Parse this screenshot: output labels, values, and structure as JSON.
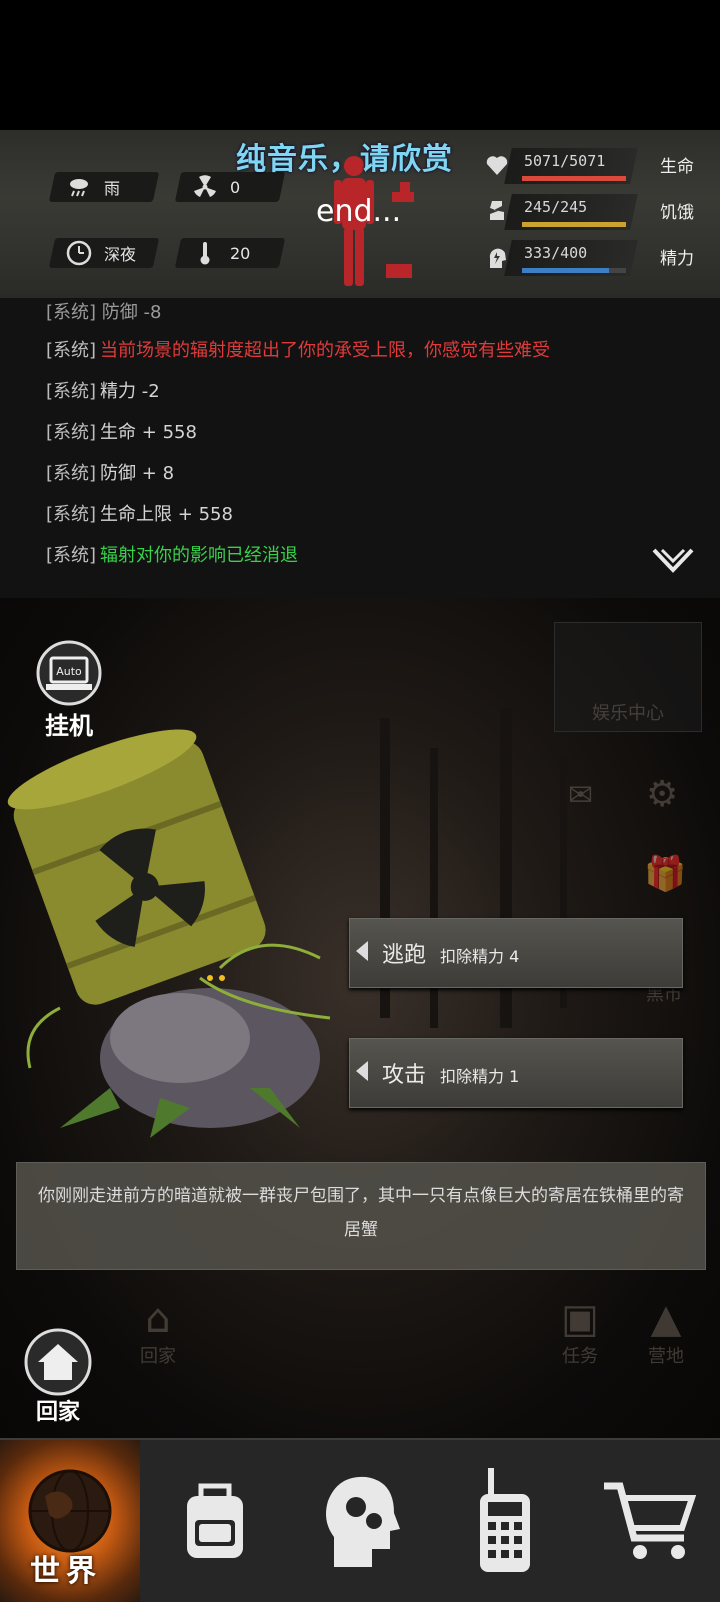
{
  "overlay": {
    "title": "纯音乐，请欣赏",
    "subtitle": "end..."
  },
  "environment": {
    "weather": "雨",
    "radiation": "0",
    "time_of_day": "深夜",
    "temperature": "20"
  },
  "stats": [
    {
      "label": "生命",
      "value": "5071/5071",
      "fill": 1.0,
      "color": "#d94a3a",
      "icon": "heart-icon"
    },
    {
      "label": "饥饿",
      "value": "245/245",
      "fill": 1.0,
      "color": "#c9a230",
      "icon": "stomach-icon"
    },
    {
      "label": "精力",
      "value": "333/400",
      "fill": 0.8325,
      "color": "#3d7fc4",
      "icon": "energy-head-icon"
    }
  ],
  "log": {
    "partial_top": "[系统] 防御 -8",
    "lines": [
      {
        "prefix": "[系统]",
        "text": "当前场景的辐射度超出了你的承受上限，你感觉有些难受",
        "color": "red"
      },
      {
        "prefix": "[系统]",
        "text": "精力 -2",
        "color": "white"
      },
      {
        "prefix": "[系统]",
        "text": "生命 + 558",
        "color": "white"
      },
      {
        "prefix": "[系统]",
        "text": "防御 + 8",
        "color": "white"
      },
      {
        "prefix": "[系统]",
        "text": "生命上限 + 558",
        "color": "white"
      },
      {
        "prefix": "[系统]",
        "text": "辐射对你的影响已经消退",
        "color": "green"
      }
    ]
  },
  "scene": {
    "auto_label": "挂机",
    "auto_badge": "Auto",
    "entertainment_label": "娱乐中心",
    "black_market_label": "黑市",
    "task_label": "任务",
    "camp_label": "营地",
    "home_label": "回家",
    "home_ghost_label": "回家"
  },
  "actions": [
    {
      "name": "逃跑",
      "cost": "扣除精力 4"
    },
    {
      "name": "攻击",
      "cost": "扣除精力 1"
    }
  ],
  "description": "你刚刚走进前方的暗道就被一群丧尸包围了，其中一只有点像巨大的寄居在铁桶里的寄居蟹",
  "nav": [
    {
      "label": "世界",
      "icon": "globe-icon",
      "active": true
    },
    {
      "label": "",
      "icon": "backpack-icon",
      "active": false
    },
    {
      "label": "",
      "icon": "skills-head-icon",
      "active": false
    },
    {
      "label": "",
      "icon": "radio-icon",
      "active": false
    },
    {
      "label": "",
      "icon": "cart-icon",
      "active": false
    }
  ],
  "colors": {
    "danger": "#e03a3a",
    "success": "#39d14a",
    "accent_orange": "#c55a12"
  }
}
